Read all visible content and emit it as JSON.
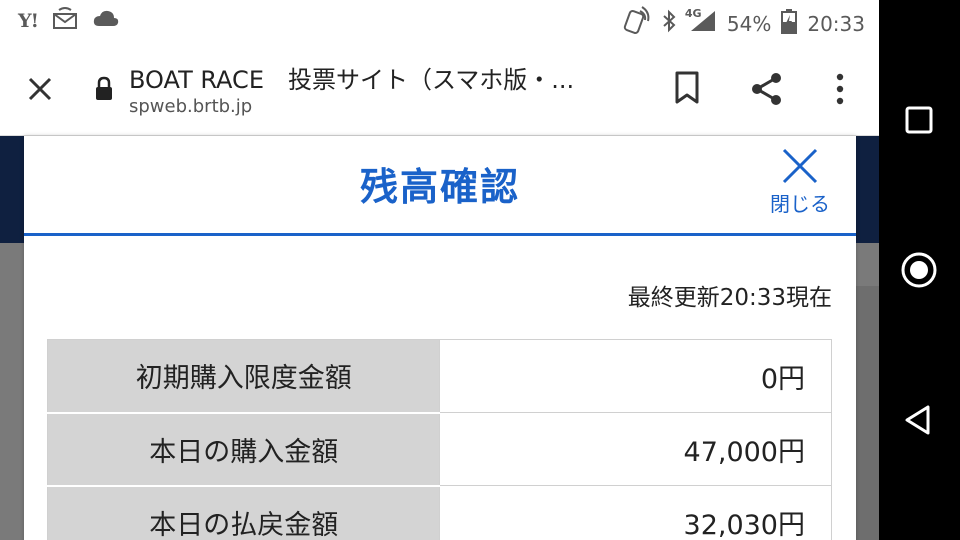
{
  "status_bar": {
    "carrier_icon": "Y!",
    "signal_label": "4G",
    "battery": "54%",
    "time": "20:33"
  },
  "browser": {
    "title": "BOAT RACE　投票サイト（スマホ版・...",
    "url": "spweb.brtb.jp"
  },
  "modal": {
    "title": "残高確認",
    "close_label": "閉じる",
    "updated": "最終更新20:33現在",
    "rows": [
      {
        "label": "初期購入限度金額",
        "value": "0円"
      },
      {
        "label": "本日の購入金額",
        "value": "47,000円"
      },
      {
        "label": "本日の払戻金額",
        "value": "32,030円"
      }
    ]
  },
  "colors": {
    "accent": "#1a62c9",
    "label_bg": "#d4d4d4"
  },
  "nav": {
    "recents": "square-icon",
    "home": "circle-icon",
    "back": "triangle-back-icon"
  }
}
